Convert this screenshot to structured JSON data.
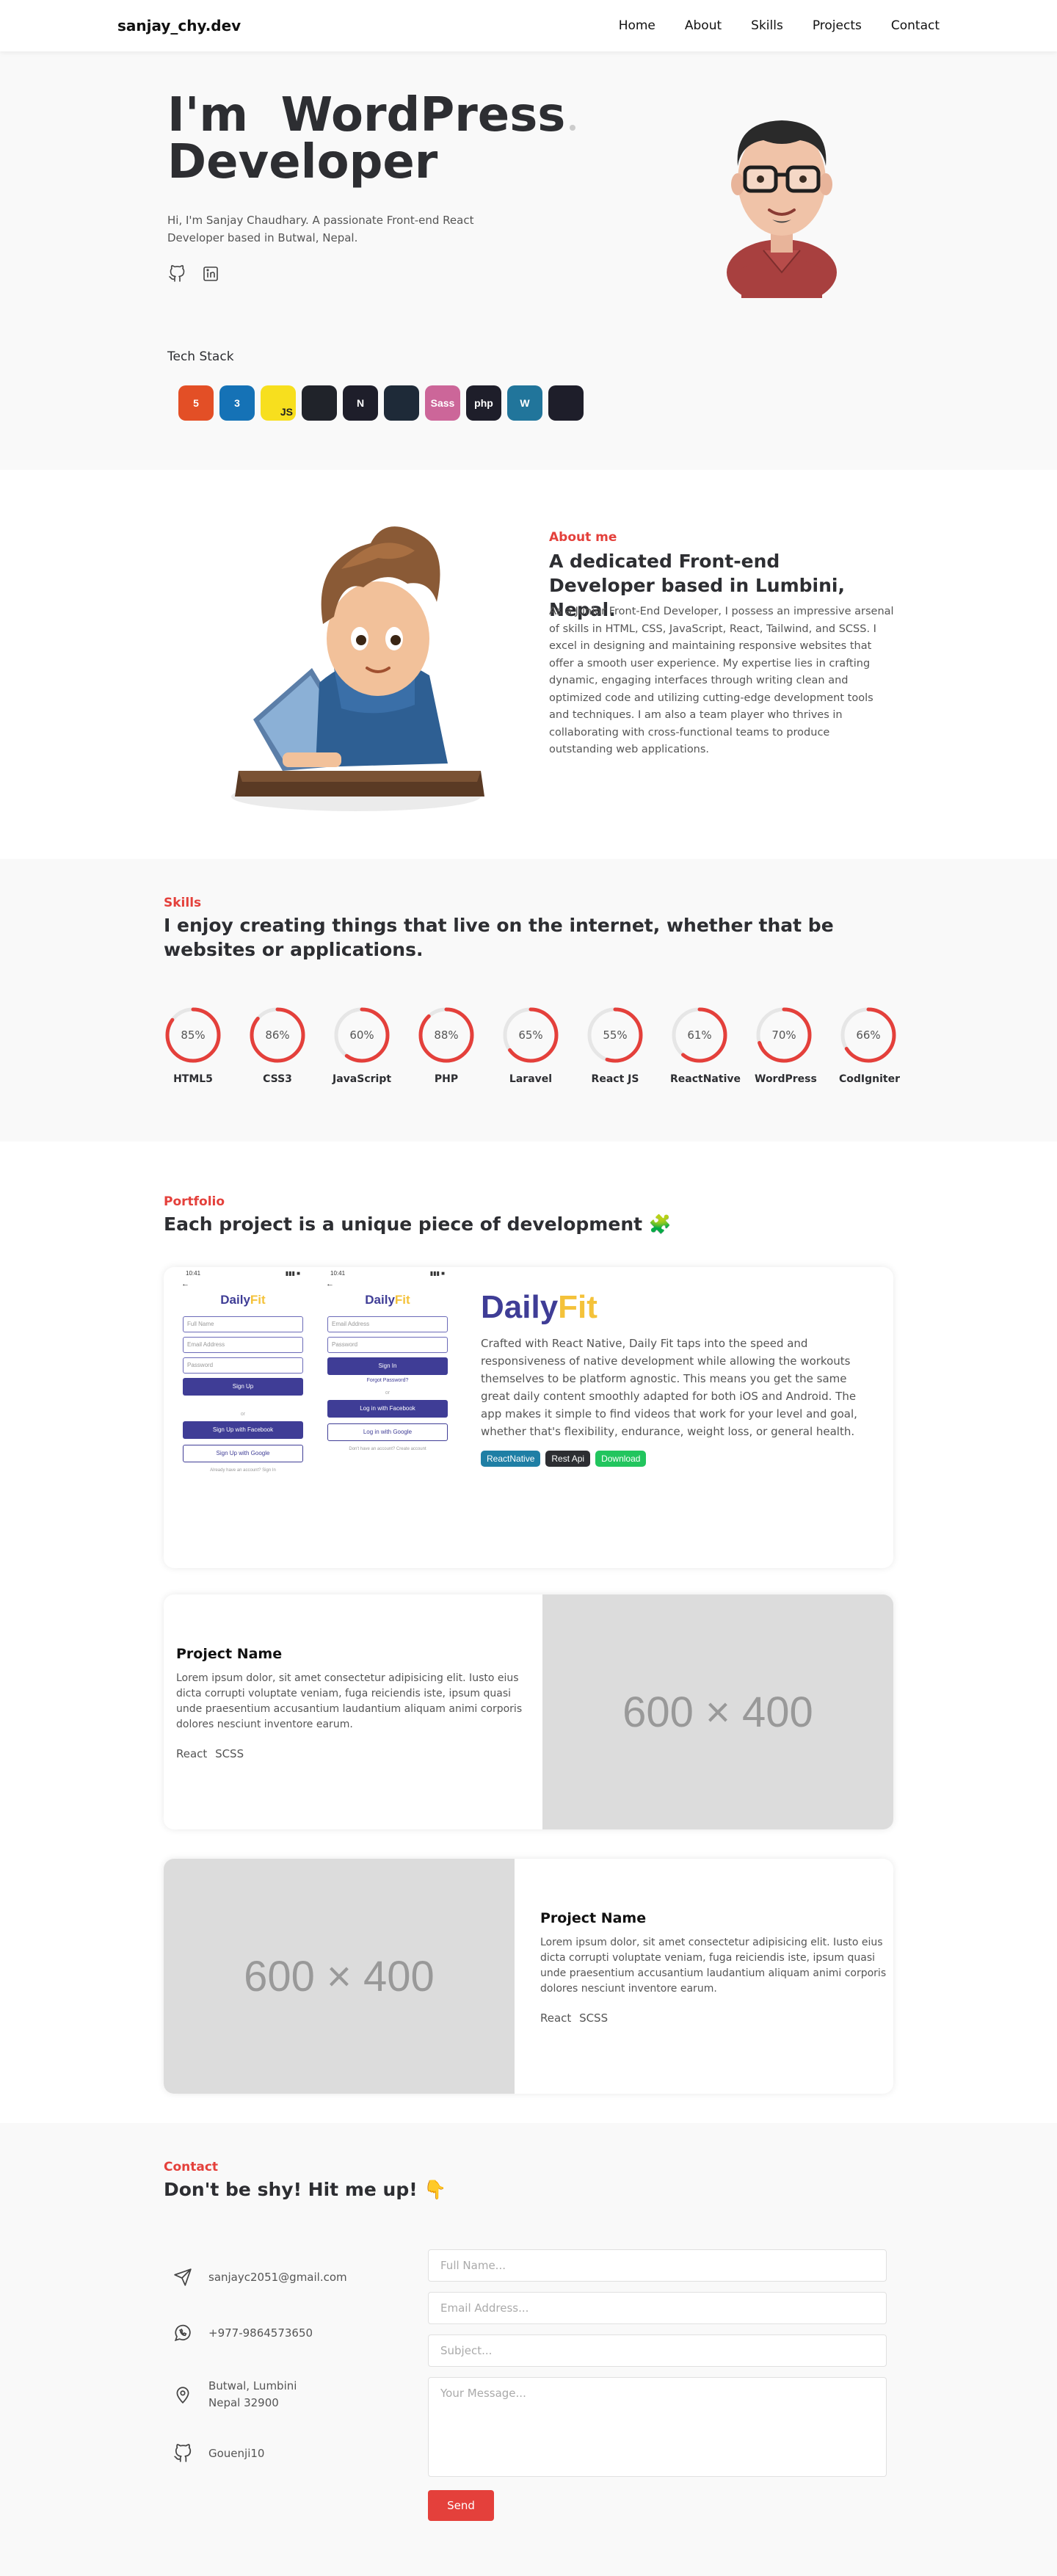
{
  "nav": {
    "logo": "sanjay_chy.dev",
    "links": [
      "Home",
      "About",
      "Skills",
      "Projects",
      "Contact"
    ]
  },
  "hero": {
    "title_line1": "I'm  WordPress",
    "title_line2": "Developer",
    "description": "Hi, I'm Sanjay Chaudhary. A passionate Front-end React Developer based in Butwal, Nepal.",
    "social_icons": [
      "github-icon",
      "linkedin-icon"
    ],
    "tech_stack_label": "Tech Stack",
    "tech_stack": [
      {
        "name": "html5-icon",
        "label": "5",
        "color": "#e34f26"
      },
      {
        "name": "css3-icon",
        "label": "3",
        "color": "#1572b6"
      },
      {
        "name": "javascript-icon",
        "label": "JS",
        "color": "#f7df1e"
      },
      {
        "name": "react-icon",
        "label": "",
        "color": "#20232a"
      },
      {
        "name": "nextjs-icon",
        "label": "N",
        "color": "#1e1e2a"
      },
      {
        "name": "tailwind-icon",
        "label": "",
        "color": "#1e2a38"
      },
      {
        "name": "sass-icon",
        "label": "Sass",
        "color": "#cc6699"
      },
      {
        "name": "php-icon",
        "label": "php",
        "color": "#1e1e2a"
      },
      {
        "name": "wordpress-icon",
        "label": "W",
        "color": "#21759b"
      },
      {
        "name": "laravel-icon",
        "label": "",
        "color": "#1e1e2a"
      }
    ]
  },
  "about": {
    "kicker": "About me",
    "title": "A dedicated Front-end Developer based in Lumbini, Nepal.",
    "text": "As a Junior Front-End Developer, I possess an impressive arsenal of skills in HTML, CSS, JavaScript, React, Tailwind, and SCSS. I excel in designing and maintaining responsive websites that offer a smooth user experience. My expertise lies in crafting dynamic, engaging interfaces through writing clean and optimized code and utilizing cutting-edge development tools and techniques. I am also a team player who thrives in collaborating with cross-functional teams to produce outstanding web applications."
  },
  "skills": {
    "kicker": "Skills",
    "title": "I enjoy creating things that live on the internet, whether that be websites or applications.",
    "items": [
      {
        "name": "HTML5",
        "percent": 85,
        "label": "85%"
      },
      {
        "name": "CSS3",
        "percent": 86,
        "label": "86%"
      },
      {
        "name": "JavaScript",
        "percent": 60,
        "label": "60%"
      },
      {
        "name": "PHP",
        "percent": 88,
        "label": "88%"
      },
      {
        "name": "Laravel",
        "percent": 65,
        "label": "65%"
      },
      {
        "name": "React JS",
        "percent": 55,
        "label": "55%"
      },
      {
        "name": "ReactNative",
        "percent": 61,
        "label": "61%"
      },
      {
        "name": "WordPress",
        "percent": 70,
        "label": "70%"
      },
      {
        "name": "CodIgniter",
        "percent": 66,
        "label": "66%"
      }
    ],
    "ring_color": "#e4403b",
    "track_color": "#e6e6e6"
  },
  "portfolio": {
    "kicker": "Portfolio",
    "title": "Each project is a unique piece of development 🧩",
    "featured": {
      "name_a": "Daily",
      "name_b": "Fit",
      "description": "Crafted with React Native, Daily Fit taps into the speed and responsiveness of native development while allowing the workouts themselves to be platform agnostic. This means you get the same great daily content smoothly adapted for both iOS and Android. The app makes it simple to find videos that work for your level and goal, whether that's flexibility, endurance, weight loss, or general health.",
      "tags": [
        {
          "label": "ReactNative",
          "color": "#1f7fa5"
        },
        {
          "label": "Rest Api",
          "color": "#2d2e32"
        },
        {
          "label": "Download",
          "color": "#22c55e"
        }
      ],
      "screen1": {
        "logo_a": "Daily",
        "logo_b": "Fit",
        "fields": [
          "Full Name",
          "Email Address",
          "Password"
        ],
        "primary": "Sign Up",
        "or": "or",
        "facebook": "Sign Up with Facebook",
        "google": "Sign Up with Google",
        "footer": "Already have an account? Sign In"
      },
      "screen2": {
        "logo_a": "Daily",
        "logo_b": "Fit",
        "fields": [
          "Email Address",
          "Password"
        ],
        "primary": "Sign In",
        "forgot": "Forgot Password?",
        "or": "or",
        "facebook": "Log in with Facebook",
        "google": "Log in with Google",
        "footer": "Don't have an account? Create account"
      }
    },
    "projects": [
      {
        "name": "Project Name",
        "description": "Lorem ipsum dolor, sit amet consectetur adipisicing elit. Iusto eius dicta corrupti voluptate veniam, fuga reiciendis iste, ipsum quasi unde praesentium accusantium laudantium aliquam animi corporis dolores nesciunt inventore earum.",
        "stack": "React SCSS",
        "placeholder": "600 × 400"
      },
      {
        "name": "Project Name",
        "description": "Lorem ipsum dolor, sit amet consectetur adipisicing elit. Iusto eius dicta corrupti voluptate veniam, fuga reiciendis iste, ipsum quasi unde praesentium accusantium laudantium aliquam animi corporis dolores nesciunt inventore earum.",
        "stack": "React SCSS",
        "placeholder": "600 × 400"
      }
    ]
  },
  "contact": {
    "kicker": "Contact",
    "title": "Don't be shy! Hit me up! 👇",
    "email": "sanjayc2051@gmail.com",
    "phone": "+977-9864573650",
    "address_line1": "Butwal, Lumbini",
    "address_line2": "Nepal 32900",
    "github": "Gouenji10",
    "form": {
      "name_placeholder": "Full Name...",
      "email_placeholder": "Email Address...",
      "subject_placeholder": "Subject...",
      "message_placeholder": "Your Message...",
      "send_label": "Send"
    }
  }
}
